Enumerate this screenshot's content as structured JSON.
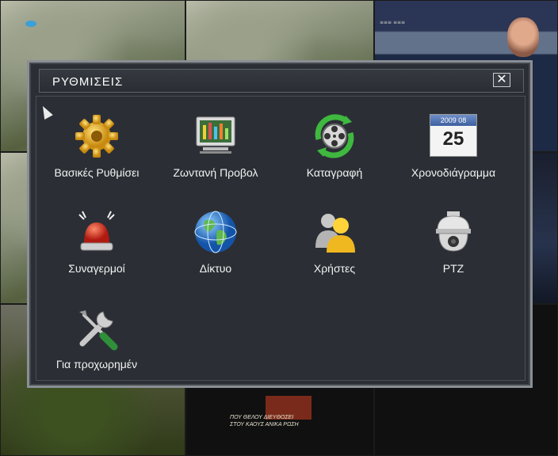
{
  "dialog": {
    "title": "ΡΥΘΜΙΣΕΙΣ",
    "close_label": "✕"
  },
  "menu": {
    "items": [
      {
        "label": "Βασικές Ρυθμίσει",
        "icon": "gear-icon"
      },
      {
        "label": "Ζωντανή Προβολ",
        "icon": "monitor-icon"
      },
      {
        "label": "Καταγραφή",
        "icon": "film-reel-icon"
      },
      {
        "label": "Χρονοδιάγραμμα",
        "icon": "calendar-icon"
      },
      {
        "label": "Συναγερμοί",
        "icon": "alarm-siren-icon"
      },
      {
        "label": "Δίκτυο",
        "icon": "globe-icon"
      },
      {
        "label": "Χρήστες",
        "icon": "users-icon"
      },
      {
        "label": "PTZ",
        "icon": "dome-camera-icon"
      },
      {
        "label": "Για προχωρημέν",
        "icon": "tools-icon"
      }
    ]
  },
  "calendar": {
    "month": "08",
    "year": "2009",
    "day": "25"
  },
  "background": {
    "overlay_text_line1": "ΠΟΥ ΘΕΛΟΥ ΔΙΕΥΘΟΣΕΙ",
    "overlay_text_line2": "ΣΤΟΥ ΚΑΟΥΣ ΑΝΙΚΑ ΡΩΣΗ"
  },
  "colors": {
    "dialog_bg": "#2b2f35",
    "dialog_border": "#8a8f95",
    "text": "#f2f2f2"
  }
}
